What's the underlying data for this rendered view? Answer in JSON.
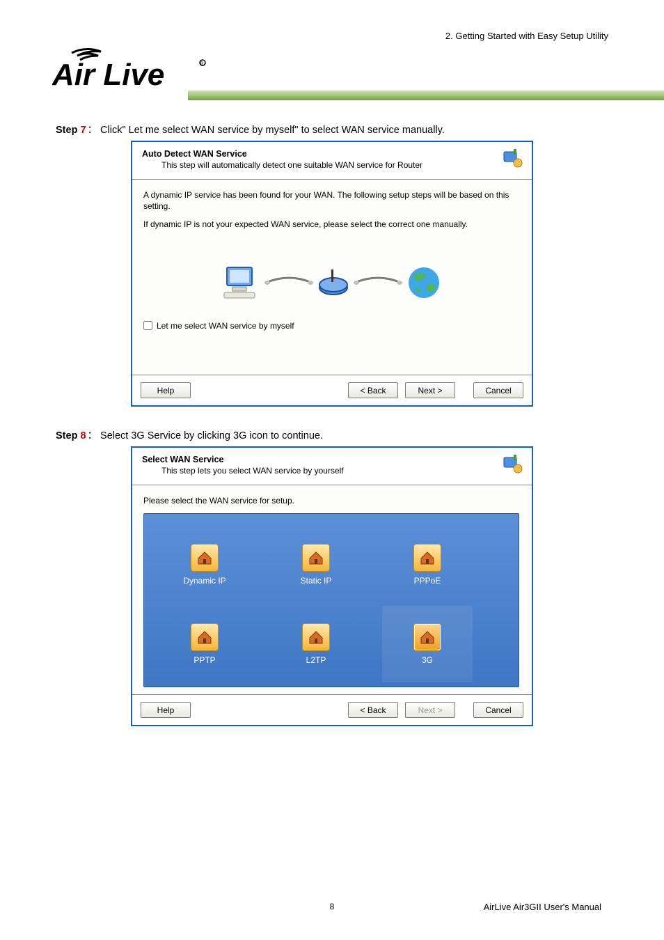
{
  "header": {
    "chapter": "2. Getting Started with Easy Setup Utility"
  },
  "logo_alt": "Air Live",
  "steps": [
    {
      "label_prefix": "Step ",
      "num": "7",
      "sep": "：",
      "text": "Click\" Let me select WAN service by myself\" to select WAN service manually."
    },
    {
      "label_prefix": "Step ",
      "num": "8",
      "sep": "：",
      "text": "Select 3G Service by clicking 3G icon to continue."
    }
  ],
  "dialog1": {
    "title": "Auto Detect WAN Service",
    "subtitle": "This step will automatically detect one suitable WAN service for Router",
    "body1": "A dynamic IP service has been found for your WAN. The following setup steps will be based on this setting.",
    "body2": "If dynamic IP is not your expected WAN service, please select the correct one manually.",
    "checkbox_label": "Let me select WAN service by myself",
    "buttons": {
      "help": "Help",
      "back": "< Back",
      "next": "Next >",
      "cancel": "Cancel"
    }
  },
  "dialog2": {
    "title": "Select WAN Service",
    "subtitle": "This step lets you select WAN service by yourself",
    "body1": "Please select the WAN service for setup.",
    "services": [
      {
        "label": "Dynamic IP"
      },
      {
        "label": "Static IP"
      },
      {
        "label": "PPPoE"
      },
      {
        "label": "PPTP"
      },
      {
        "label": "L2TP"
      },
      {
        "label": "3G"
      }
    ],
    "buttons": {
      "help": "Help",
      "back": "< Back",
      "next": "Next >",
      "cancel": "Cancel"
    }
  },
  "footer": {
    "page": "8",
    "manual": "AirLive Air3GII User's Manual"
  }
}
